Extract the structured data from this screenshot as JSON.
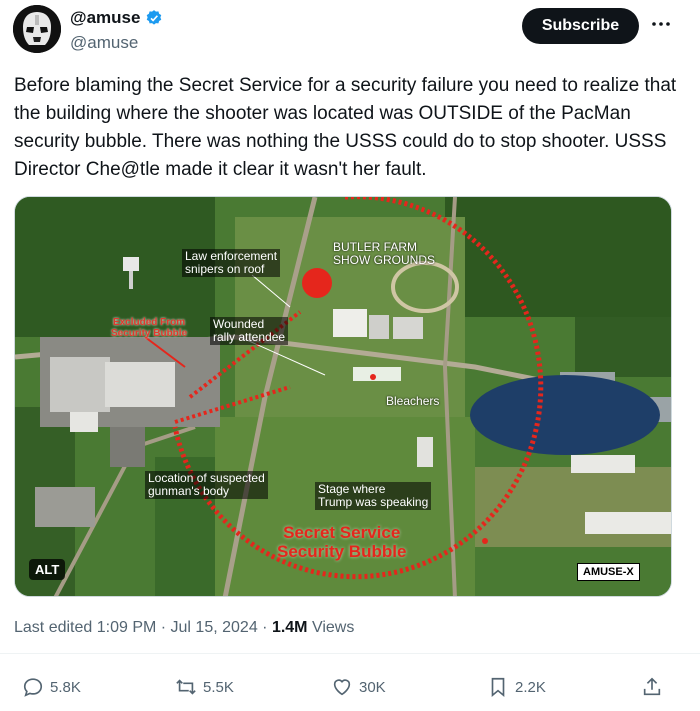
{
  "author": {
    "display_name": "@amuse",
    "handle": "@amuse",
    "verified": true
  },
  "buttons": {
    "subscribe": "Subscribe",
    "more_icon": "more-horizontal-icon"
  },
  "tweet": {
    "text": "Before blaming the Secret Service for a security failure you need to realize that the building where the shooter was located was OUTSIDE of the PacMan security bubble. There was nothing the USSS could do to stop shooter. USSS Director Che@tle made it clear it wasn't her fault."
  },
  "media": {
    "labels": {
      "law_enforcement": "Law enforcement\nsnipers on roof",
      "butler_farm": "BUTLER FARM\nSHOW GROUNDS",
      "excluded": "Excluded From\nSecurity Bubble",
      "wounded": "Wounded\nrally attendee",
      "bleachers": "Bleachers",
      "gunman": "Location of suspected\ngunman's body",
      "stage": "Stage where\nTrump was speaking",
      "bubble": "Secret Service\nSecurity Bubble"
    },
    "alt_badge": "ALT",
    "watermark": "AMUSE-X",
    "colors": {
      "bubble_red": "#e5261c"
    }
  },
  "meta": {
    "edited": "Last edited 1:09 PM · Jul 15, 2024 · ",
    "views_count": "1.4M",
    "views_label": " Views"
  },
  "actions": {
    "replies": "5.8K",
    "reposts": "5.5K",
    "likes": "30K",
    "bookmarks": "2.2K"
  }
}
